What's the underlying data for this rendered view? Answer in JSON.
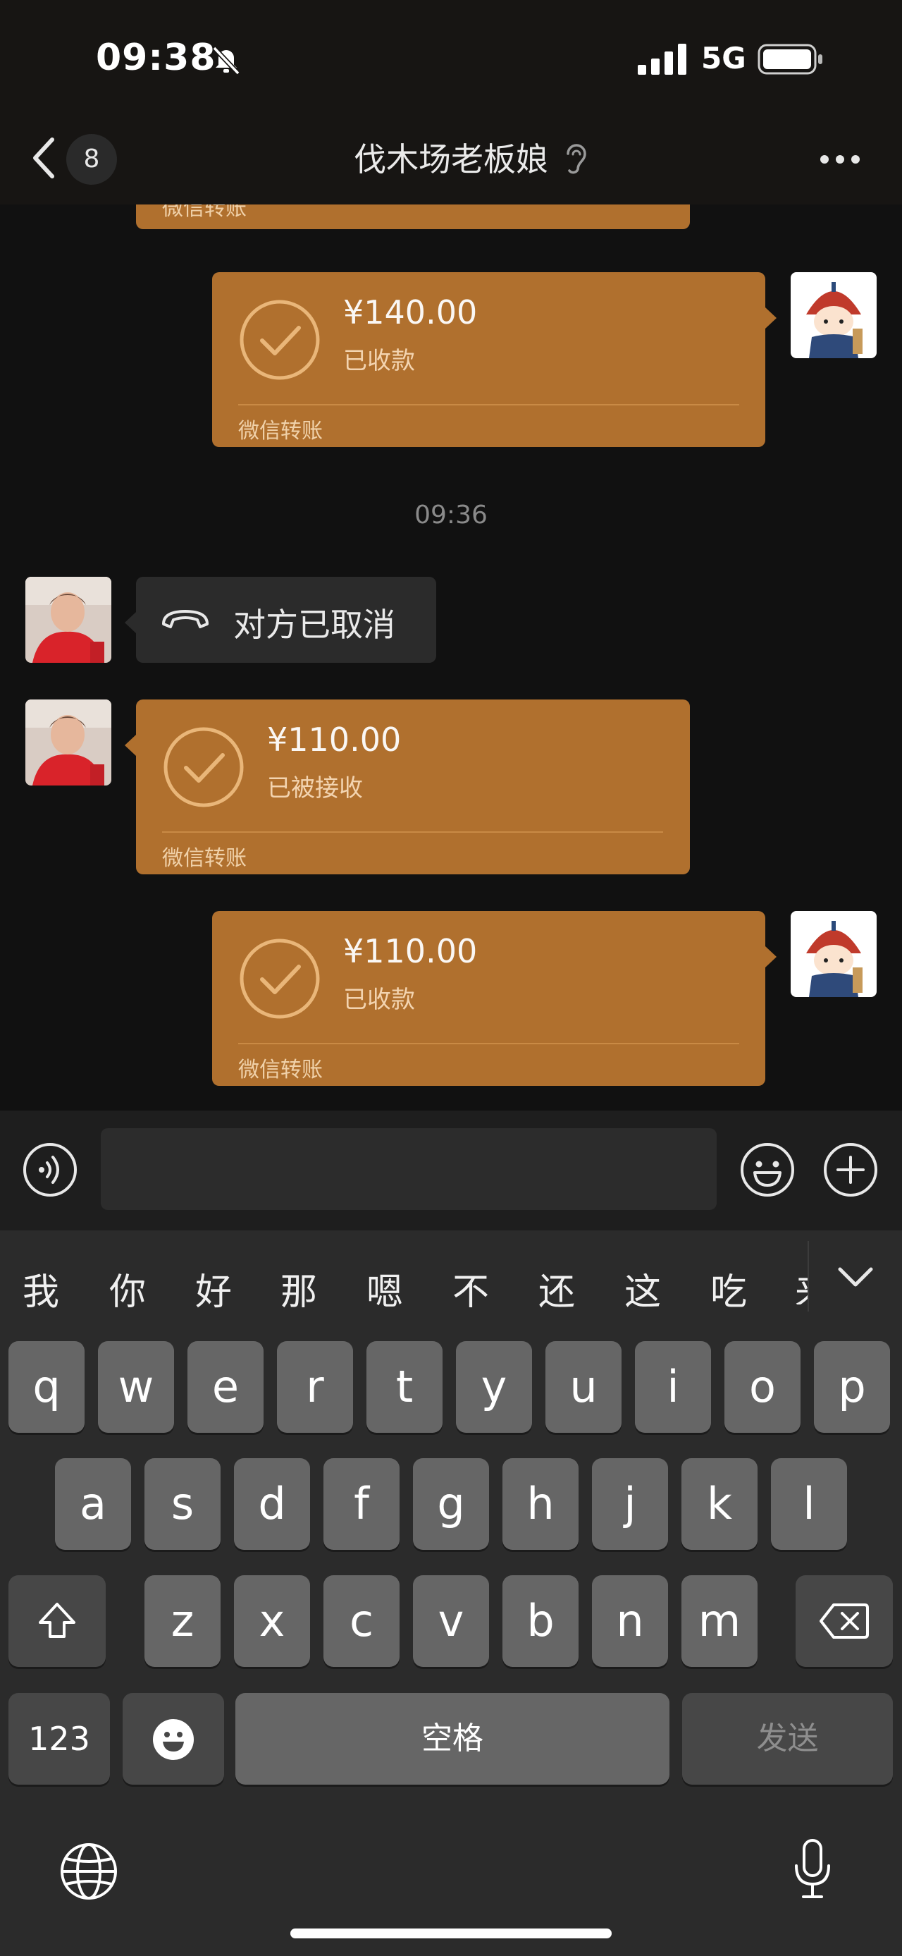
{
  "status_bar": {
    "time": "09:38",
    "network": "5G"
  },
  "header": {
    "unread_count": "8",
    "title": "伐木场老板娘"
  },
  "messages": {
    "partial_top": {
      "kind": "微信转账"
    },
    "transfer_1": {
      "amount": "¥140.00",
      "status": "已收款",
      "kind": "微信转账",
      "sender": "me"
    },
    "timestamp": "09:36",
    "call": {
      "text": "对方已取消",
      "sender": "contact"
    },
    "transfer_2": {
      "amount": "¥110.00",
      "status": "已被接收",
      "kind": "微信转账",
      "sender": "contact"
    },
    "transfer_3": {
      "amount": "¥110.00",
      "status": "已收款",
      "kind": "微信转账",
      "sender": "me"
    }
  },
  "input": {
    "value": ""
  },
  "keyboard": {
    "candidates": [
      "我",
      "你",
      "好",
      "那",
      "嗯",
      "不",
      "还",
      "这",
      "吃",
      "来"
    ],
    "row1": [
      "q",
      "w",
      "e",
      "r",
      "t",
      "y",
      "u",
      "i",
      "o",
      "p"
    ],
    "row2": [
      "a",
      "s",
      "d",
      "f",
      "g",
      "h",
      "j",
      "k",
      "l"
    ],
    "row3": [
      "z",
      "x",
      "c",
      "v",
      "b",
      "n",
      "m"
    ],
    "numbers_label": "123",
    "space_label": "空格",
    "send_label": "发送"
  },
  "colors": {
    "transfer_bubble": "#b0702e",
    "background": "#111111",
    "keyboard": "#2b2b2b"
  }
}
